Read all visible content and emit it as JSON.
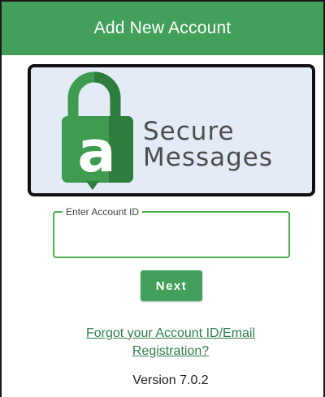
{
  "header": {
    "title": "Add New Account"
  },
  "logo": {
    "line1": "Secure",
    "line2": "Messages",
    "letter": "a"
  },
  "account_field": {
    "label": "Enter Account ID",
    "value": "",
    "placeholder": ""
  },
  "next_button": {
    "label": "Next"
  },
  "forgot_link": {
    "line1": "Forgot your Account ID/Email",
    "line2": "Registration?"
  },
  "footer": {
    "version": "Version 7.0.2"
  },
  "colors": {
    "brand_green": "#43a05a",
    "field_border": "#4caf50",
    "logo_background": "#e3ebf7",
    "link": "#2e7d4f"
  },
  "icons": [
    "padlock-icon",
    "speech-bubble-icon"
  ]
}
